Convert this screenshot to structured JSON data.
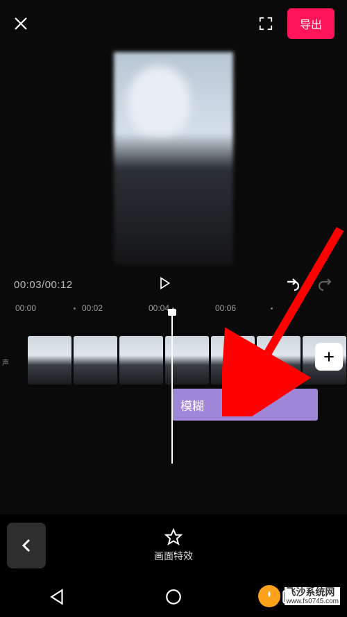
{
  "header": {
    "export_label": "导出"
  },
  "playback": {
    "current_time": "00:03",
    "total_time": "00:12",
    "combined": "00:03/00:12"
  },
  "ruler": {
    "ticks": [
      "00:00",
      "00:02",
      "00:04",
      "00:06"
    ]
  },
  "timeline": {
    "audio_label": "声",
    "effect_clip_label": "模糊"
  },
  "toolbar": {
    "back_icon": "‹",
    "picture_effect_label": "画面特效"
  },
  "watermark": {
    "brand": "飞沙系统网",
    "url": "www.fs0745.com"
  }
}
